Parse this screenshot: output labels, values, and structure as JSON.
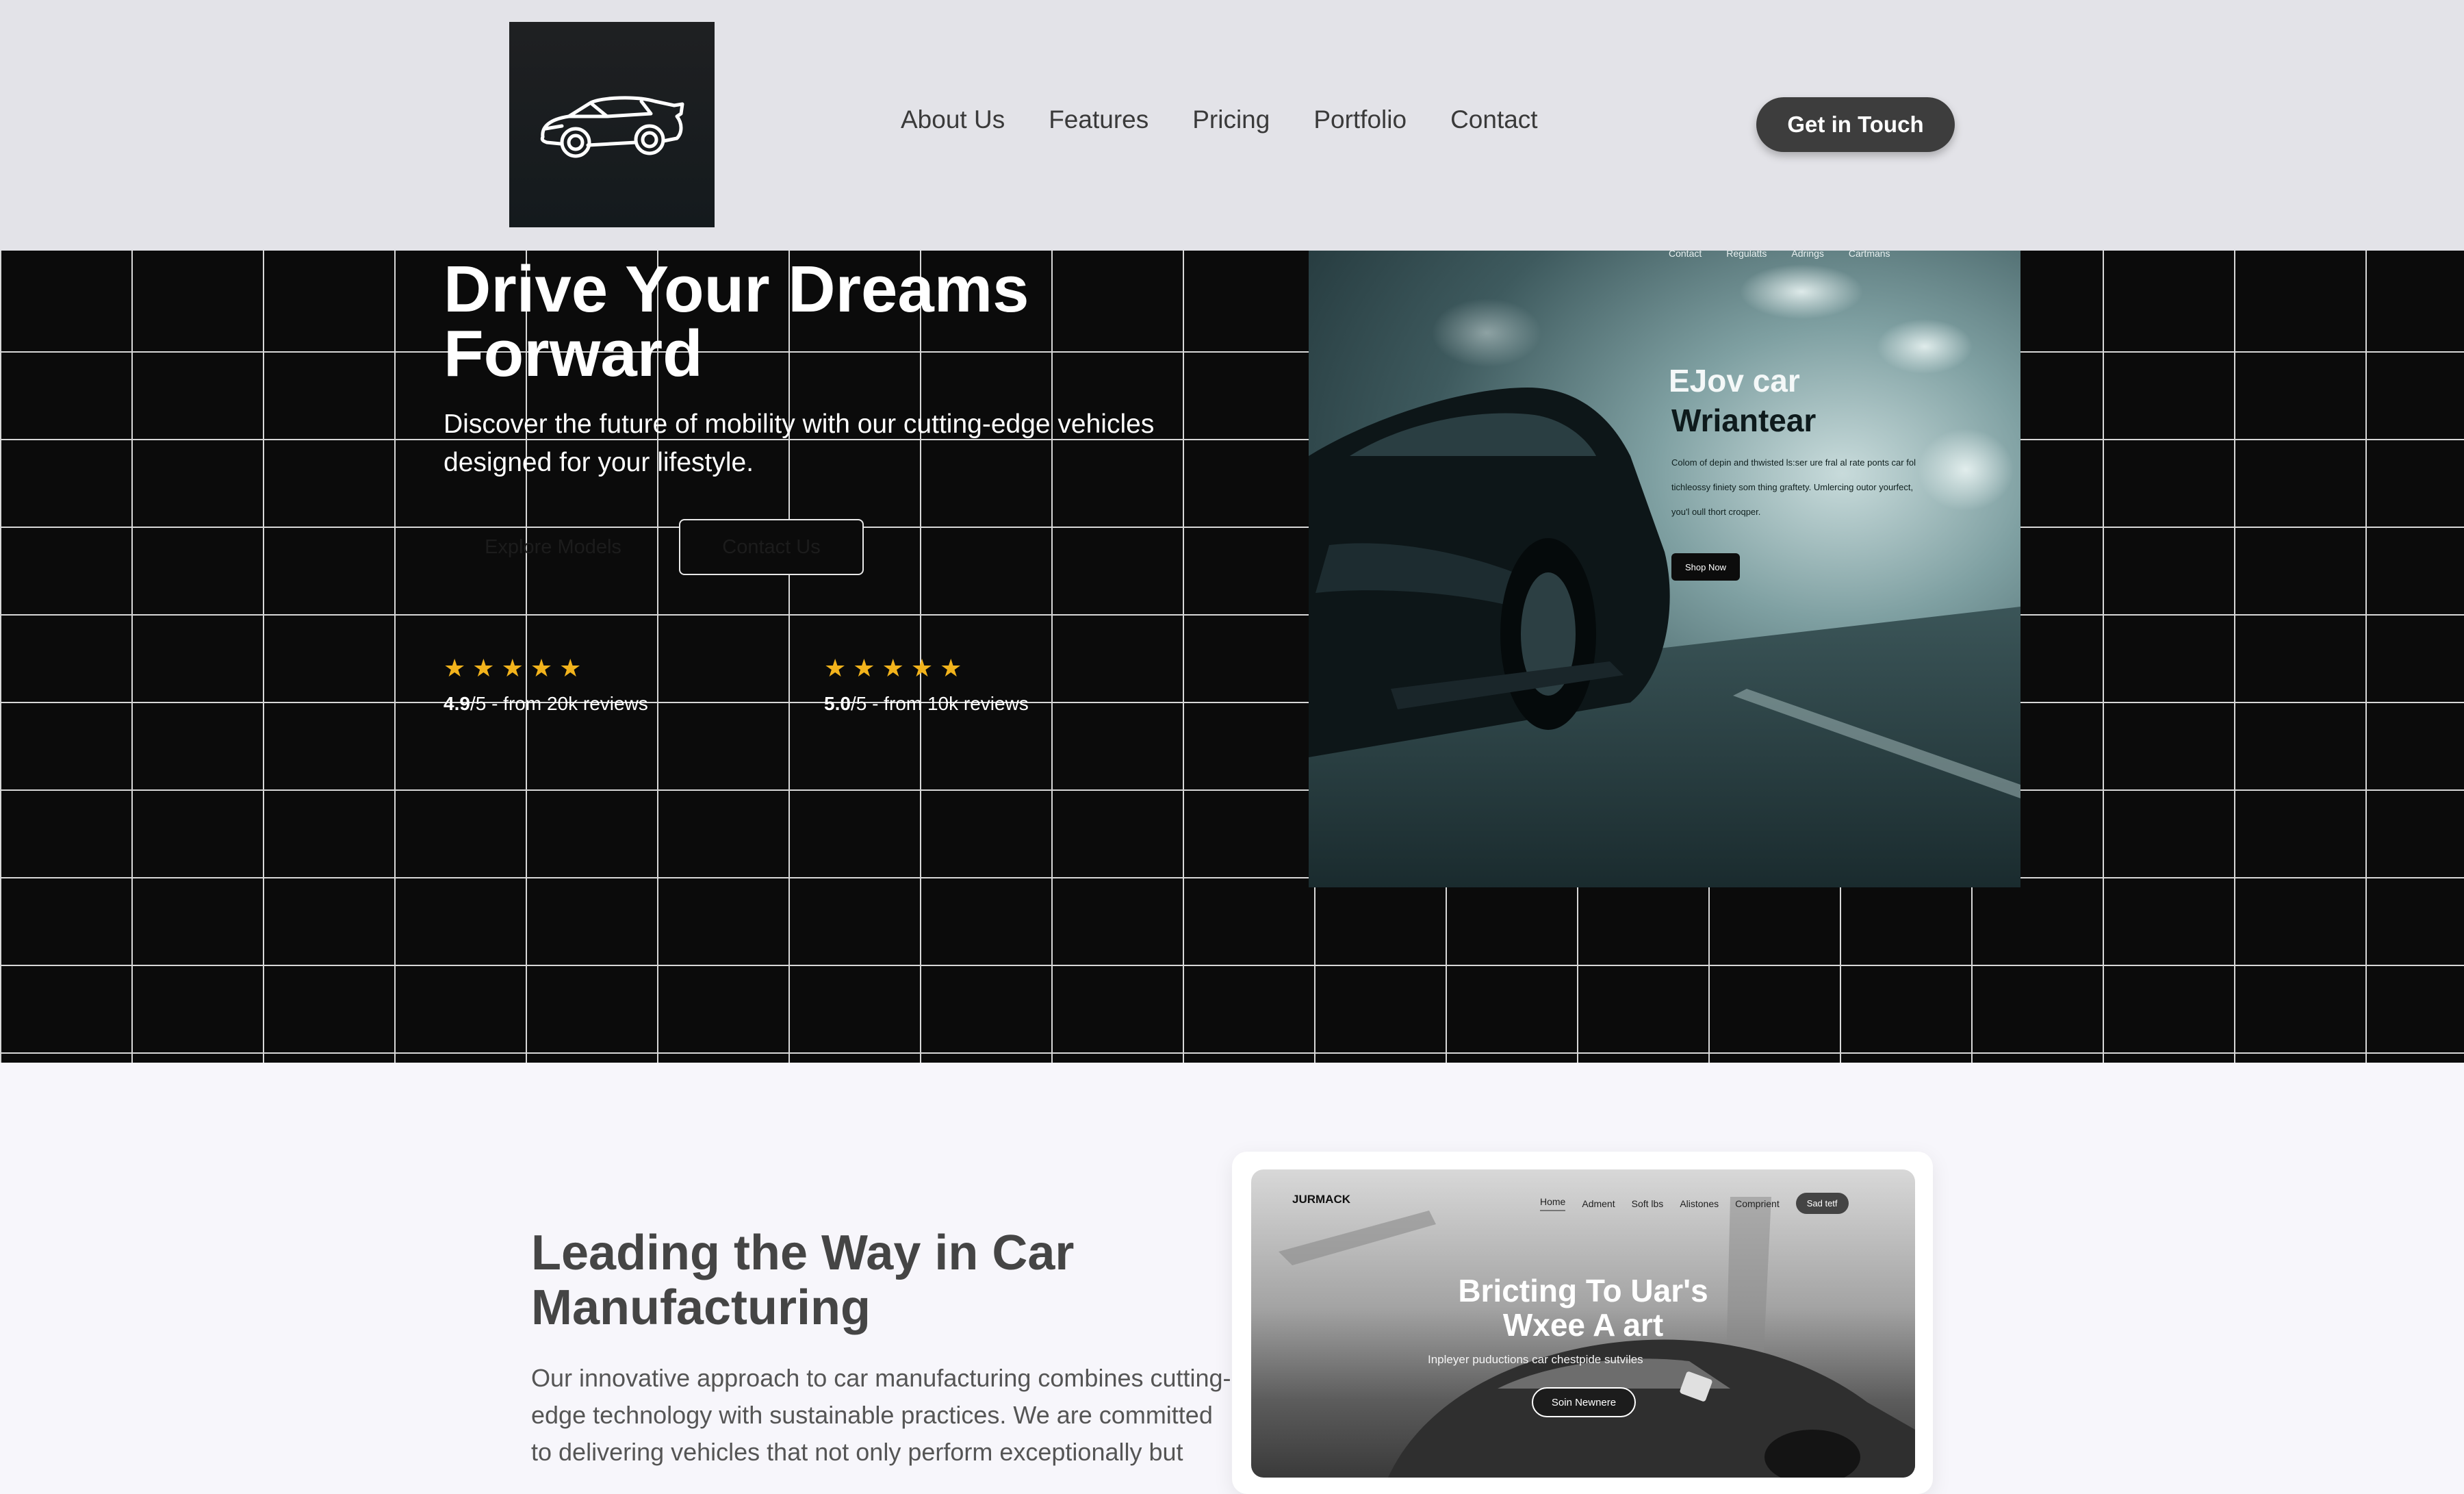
{
  "header": {
    "nav": [
      "About Us",
      "Features",
      "Pricing",
      "Portfolio",
      "Contact"
    ],
    "cta": "Get in Touch"
  },
  "hero": {
    "title": "Drive Your Dreams Forward",
    "subtitle": "Discover the future of mobility with our cutting-edge vehicles designed for your lifestyle.",
    "explore_label": "Explore Models",
    "contact_label": "Contact Us",
    "ratings": [
      {
        "score": "4.9",
        "suffix": "/5 - from 20k reviews",
        "stars": 5
      },
      {
        "score": "5.0",
        "suffix": "/5 - from 10k reviews",
        "stars": 5
      }
    ],
    "image": {
      "nav": [
        "Contact",
        "Regulatts",
        "Adrings",
        "Cartmans"
      ],
      "heading_line1": "EJov car",
      "heading_line2": "Wriantear",
      "body": "Colom of depin and thwisted ls:ser ure fral al rate ponts car fol tichleossy finiety som thing graftety. Umlercing outor yourfect, you'l oull thort croqper.",
      "button": "Shop Now"
    }
  },
  "about": {
    "title": "Leading the Way in Car Manufacturing",
    "text": "Our innovative approach to car manufacturing combines cutting-edge technology with sustainable practices. We are committed to delivering vehicles that not only perform exceptionally but",
    "preview": {
      "brand": "JURMACK",
      "nav": [
        "Home",
        "Adment",
        "Soft lbs",
        "Alistones",
        "Comprient"
      ],
      "nav_button": "Sad tetf",
      "title_line1": "Bricting To Uar's",
      "title_line2": "Wxee A art",
      "subtitle": "Inpleyer puductions car chestpide sutviles",
      "cta": "Soin Newnere"
    }
  },
  "colors": {
    "star": "#f2b31c",
    "hero_bg": "#0b0b0b",
    "header_bg": "#e3e3e8",
    "button_dark": "#3d3d3d"
  }
}
